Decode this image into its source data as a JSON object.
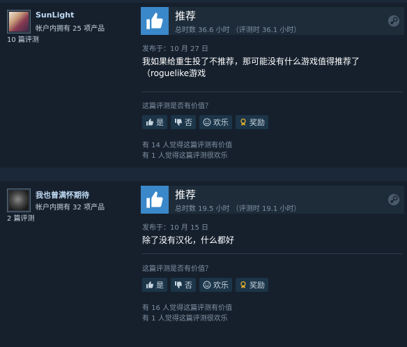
{
  "reviews": [
    {
      "author_name": "SunLight",
      "games_owned": "帐户内拥有 25 项产品",
      "review_count": "10 篇评测",
      "verdict": "推荐",
      "hours": "总时数 36.6 小时 （评测时 36.1 小时）",
      "posted": "发布于：10 月 27 日",
      "body_line1": "我如果给重生投了不推荐，那可能没有什么游戏值得推荐了",
      "body_line2": "（roguelike游戏",
      "helpful_question": "这篇评测是否有价值？",
      "btn_yes": "是",
      "btn_no": "否",
      "btn_funny": "欢乐",
      "btn_award": "奖励",
      "helpful_stat": "有 14 人觉得这篇评测有价值",
      "funny_stat": "有 1 人觉得这篇评测很欢乐"
    },
    {
      "author_name": "我也曾满怀期待",
      "games_owned": "帐户内拥有 32 项产品",
      "review_count": "2 篇评测",
      "verdict": "推荐",
      "hours": "总时数 19.5 小时 （评测时 19.1 小时）",
      "posted": "发布于：10 月 15 日",
      "body_line1": "除了没有汉化，什么都好",
      "body_line2": "",
      "helpful_question": "这篇评测是否有价值？",
      "btn_yes": "是",
      "btn_no": "否",
      "btn_funny": "欢乐",
      "btn_award": "奖励",
      "helpful_stat": "有 16 人觉得这篇评测有价值",
      "funny_stat": "有 1 人觉得这篇评测很欢乐"
    }
  ],
  "colors": {
    "background": "#1b2838",
    "card": "#16202d",
    "thumb_blue": "#3a88c9",
    "author_name": "#c1dbf4",
    "muted": "#8091a2",
    "award_gold": "#e1b12c"
  },
  "icons": {
    "thumb": "thumbs-up-icon",
    "steam": "steam-icon",
    "yes": "thumbs-up-small-icon",
    "no": "thumbs-down-icon",
    "funny": "smiley-icon",
    "award": "award-ribbon-icon"
  }
}
